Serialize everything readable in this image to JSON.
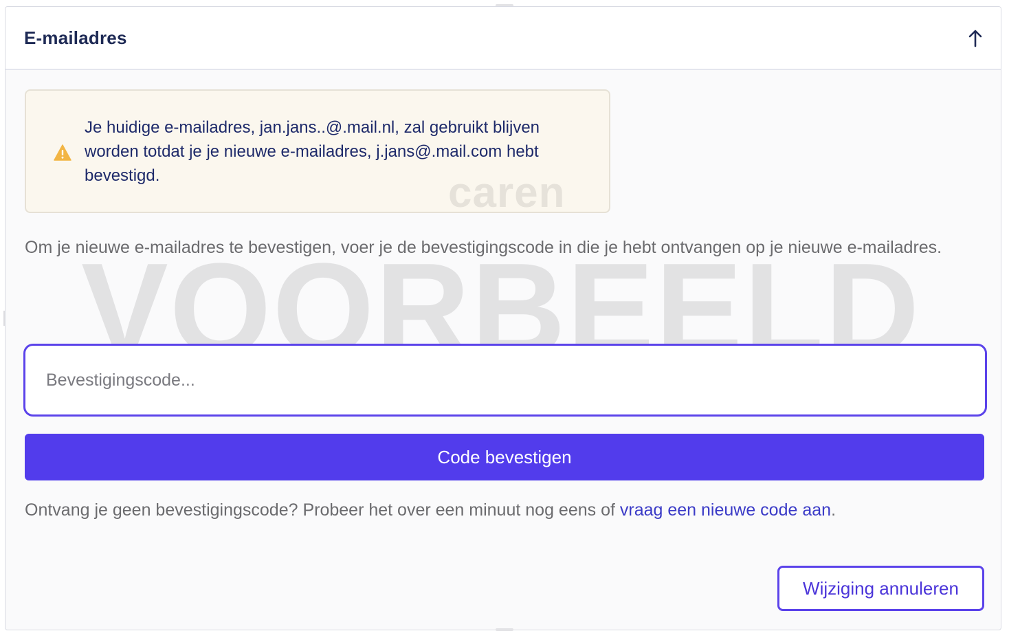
{
  "section": {
    "title": "E-mailadres",
    "collapse_icon": "arrow-up-icon"
  },
  "warning": {
    "icon": "warning-triangle-icon",
    "icon_color": "#F2B544",
    "text": "Je huidige e-mailadres, jan.jans..@.mail.nl, zal gebruikt blijven worden totdat je je nieuwe e-mailadres, j.jans@.mail.com hebt bevestigd."
  },
  "watermarks": {
    "brand": "caren",
    "main": "VOORBEELD"
  },
  "instruction": "Om je nieuwe e-mailadres te bevestigen, voer je de bevestigingscode in die je hebt ontvangen op je nieuwe e-mailadres.",
  "code_input": {
    "placeholder": "Bevestigingscode...",
    "value": ""
  },
  "confirm_button": {
    "label": "Code bevestigen",
    "color": "#523CEC"
  },
  "resend": {
    "text": "Ontvang je geen bevestigingscode? Probeer het over een minuut nog eens of ",
    "link": "vraag een nieuwe code aan",
    "suffix": "."
  },
  "cancel_button": {
    "label": "Wijziging annuleren"
  }
}
